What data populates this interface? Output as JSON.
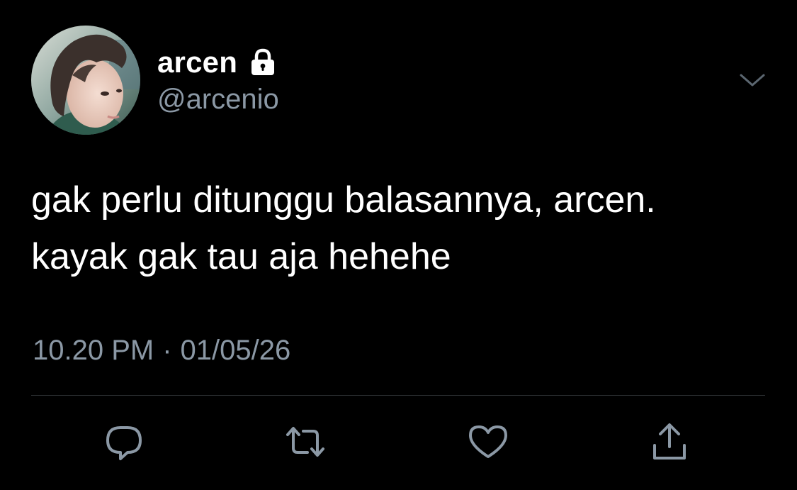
{
  "user": {
    "display_name": "arcen",
    "handle": "@arcenio",
    "protected": true
  },
  "tweet": {
    "text": "gak perlu ditunggu balasannya, arcen.\nkayak gak tau aja hehehe",
    "time": "10.20 PM",
    "separator": "·",
    "date": "01/05/26"
  },
  "actions": [
    {
      "icon": "reply-icon"
    },
    {
      "icon": "retweet-icon"
    },
    {
      "icon": "like-icon"
    },
    {
      "icon": "share-icon"
    }
  ],
  "colors": {
    "background": "#000000",
    "text": "#ffffff",
    "secondary": "#8b98a5",
    "divider": "#2f3336",
    "icon": "#8b98a5"
  }
}
